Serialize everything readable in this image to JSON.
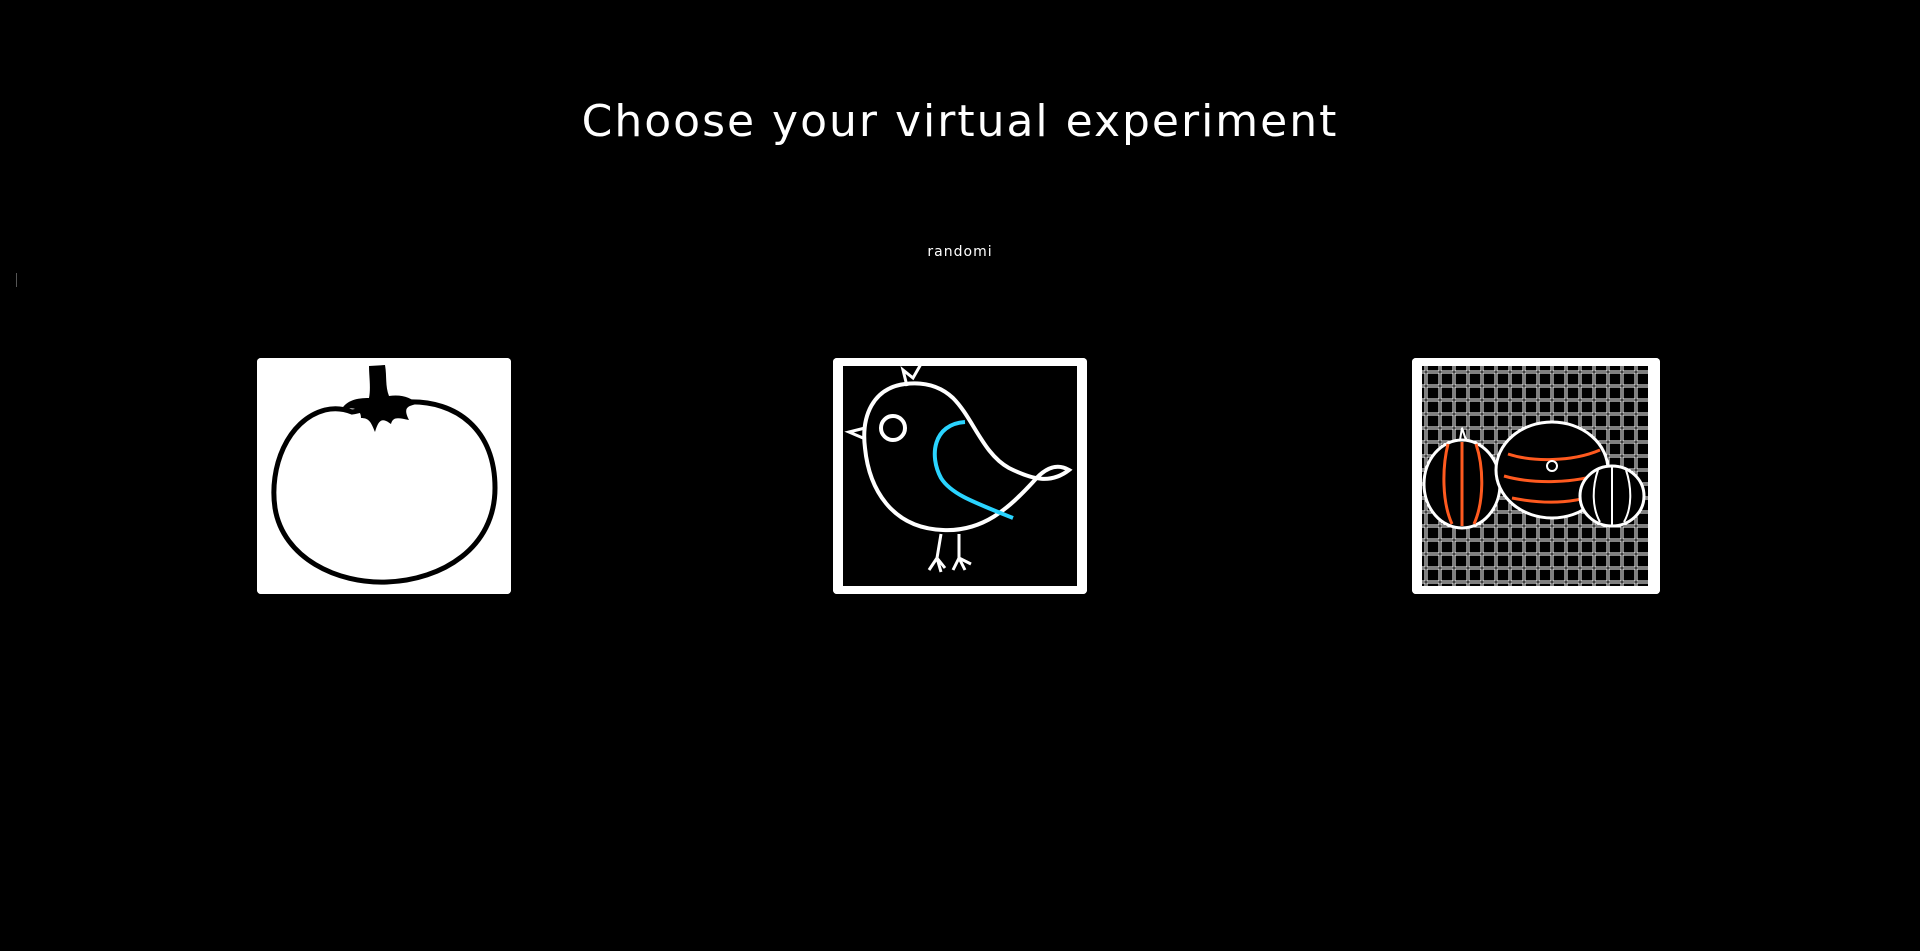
{
  "page": {
    "title": "Choose your virtual experiment",
    "random_label": "randomi"
  },
  "experiments": [
    {
      "subject": "tomato",
      "icon": "tomato-outline-icon",
      "style": "black-outline-on-white"
    },
    {
      "subject": "bird",
      "icon": "bird-outline-icon",
      "style": "white-outline-on-black"
    },
    {
      "subject": "pumpkins",
      "icon": "pumpkins-edge-icon",
      "style": "edge-detected-on-checker"
    }
  ],
  "colors": {
    "background": "#000000",
    "text": "#ffffff",
    "bird_wing": "#2ad4ff",
    "pumpkin_edges": "#ff5a1f"
  }
}
